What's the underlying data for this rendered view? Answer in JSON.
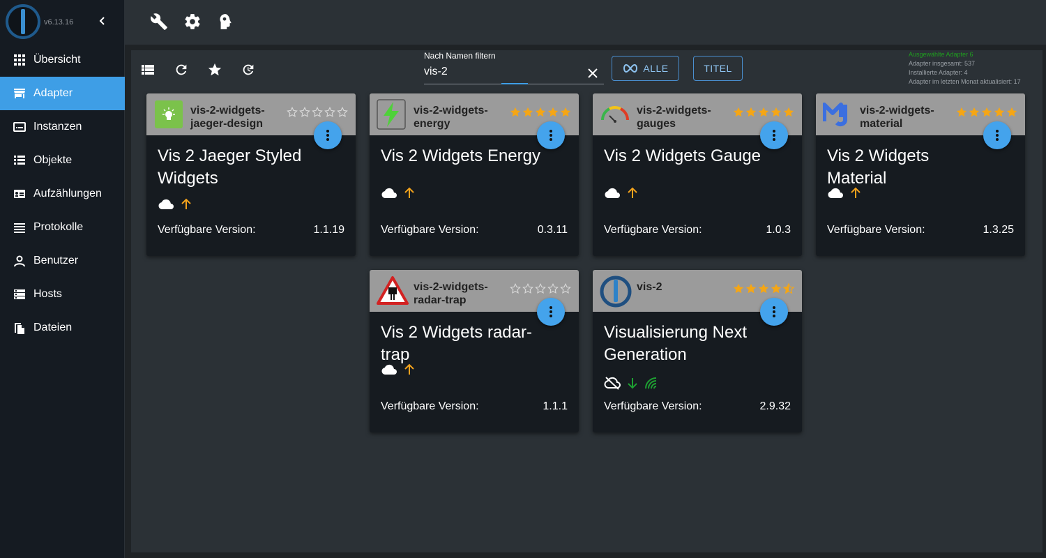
{
  "app": {
    "version": "v6.13.16"
  },
  "nav": [
    {
      "label": "Übersicht",
      "icon": "grid-icon"
    },
    {
      "label": "Adapter",
      "icon": "store-icon",
      "active": true
    },
    {
      "label": "Instanzen",
      "icon": "instances-icon"
    },
    {
      "label": "Objekte",
      "icon": "list-icon"
    },
    {
      "label": "Aufzählungen",
      "icon": "enums-icon"
    },
    {
      "label": "Protokolle",
      "icon": "lines-icon"
    },
    {
      "label": "Benutzer",
      "icon": "user-icon"
    },
    {
      "label": "Hosts",
      "icon": "hosts-icon"
    },
    {
      "label": "Dateien",
      "icon": "files-icon"
    }
  ],
  "filter": {
    "label": "Nach Namen filtern",
    "value": "vis-2"
  },
  "buttons": {
    "all": "ALLE",
    "title": "TITEL"
  },
  "stats": {
    "selected": "Ausgewählte Adapter 6",
    "total": "Adapter insgesamt: 537",
    "installed": "Installierte Adapter: 4",
    "updated": "Adapter im letzten Monat aktualisiert: 17"
  },
  "version_label": "Verfügbare Version:",
  "cards": [
    {
      "name": "vis-2-widgets-jaeger-design",
      "title": "Vis 2 Jaeger Styled Widgets",
      "version": "1.1.19",
      "rating": 0,
      "icon": "jaeger-icon",
      "status": "cloud-up"
    },
    {
      "name": "vis-2-widgets-energy",
      "title": "Vis 2 Widgets Energy",
      "version": "0.3.11",
      "rating": 5,
      "icon": "energy-icon",
      "status": "cloud-up"
    },
    {
      "name": "vis-2-widgets-gauges",
      "title": "Vis 2 Widgets Gauge",
      "version": "1.0.3",
      "rating": 5,
      "icon": "gauge-icon",
      "status": "cloud-up"
    },
    {
      "name": "vis-2-widgets-material",
      "title": "Vis 2 Widgets Material",
      "version": "1.3.25",
      "rating": 5,
      "icon": "material-icon",
      "status": "cloud-up"
    },
    {
      "name": "vis-2-widgets-radar-trap",
      "title": "Vis 2 Widgets radar-trap",
      "version": "1.1.1",
      "rating": 0,
      "icon": "radar-trap-icon",
      "status": "cloud-up"
    },
    {
      "name": "vis-2",
      "title": "Visualisierung Next Generation",
      "version": "2.9.32",
      "rating": 4.5,
      "icon": "iobroker-icon",
      "status": "cloud-off-down-signal"
    }
  ]
}
